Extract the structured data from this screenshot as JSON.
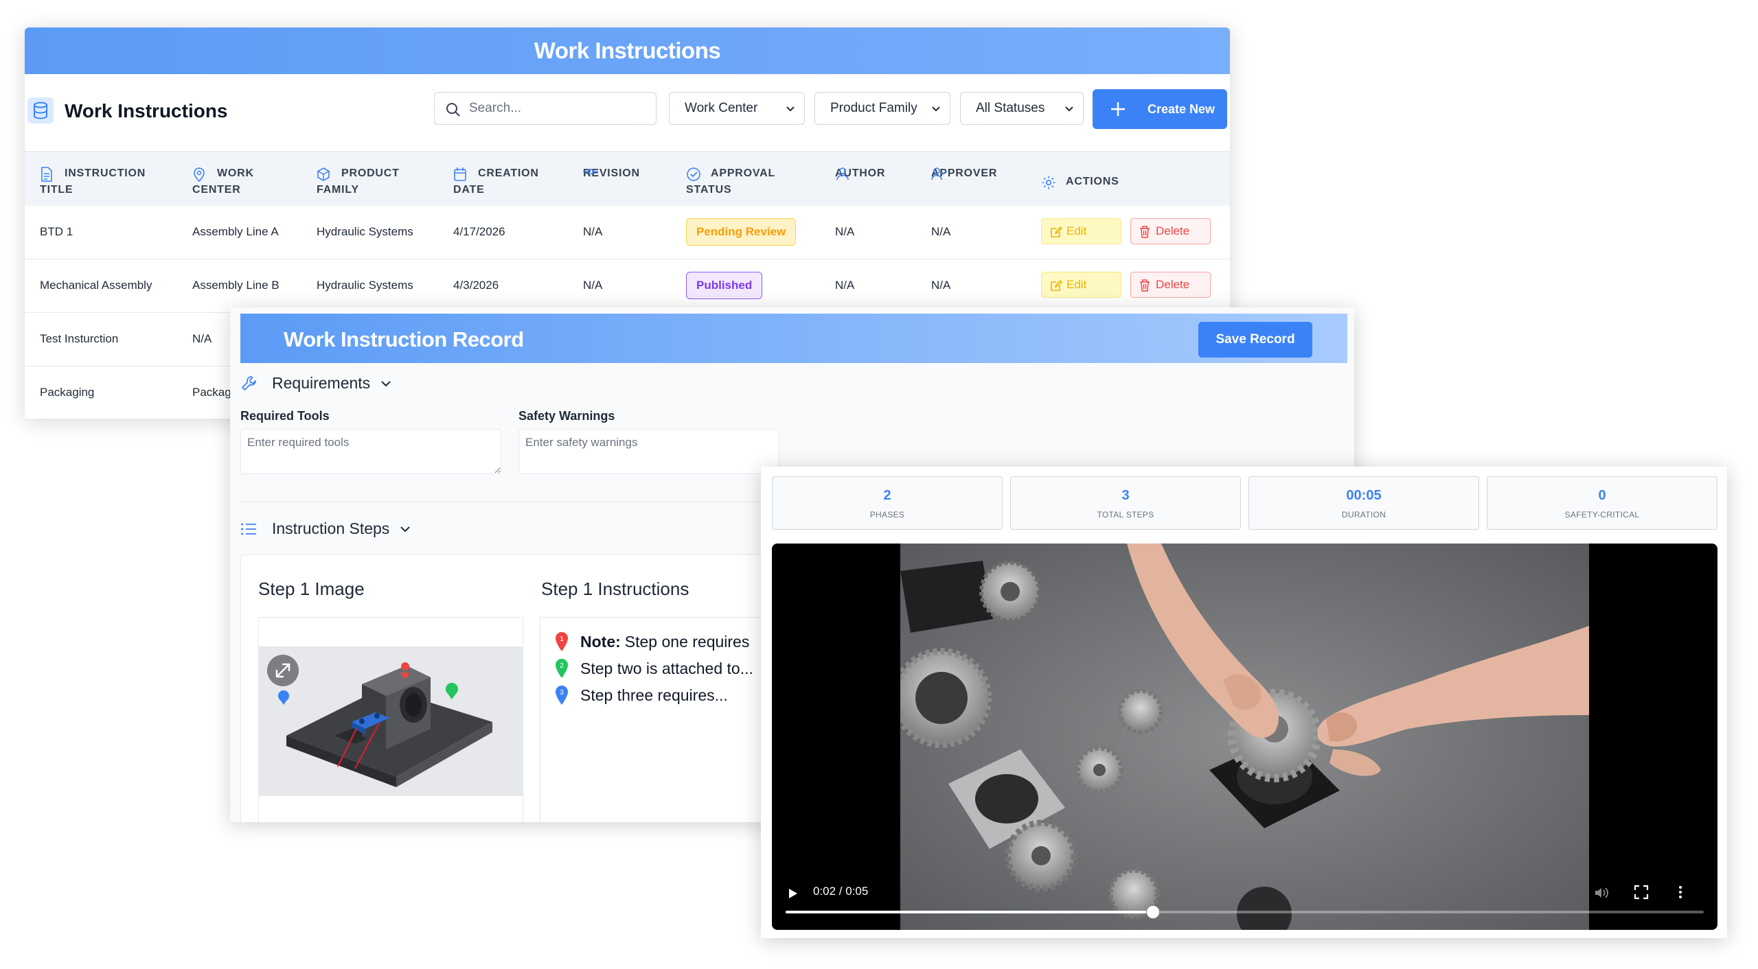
{
  "list_panel": {
    "title_bar": "Work Instructions",
    "heading": "Work Instructions",
    "search": {
      "placeholder": "Search..."
    },
    "filters": [
      "Work Center",
      "Product Family",
      "All Statuses"
    ],
    "create_button": "Create New",
    "columns": [
      {
        "line1": "Instruction",
        "line2": "Title",
        "icon": "document-icon"
      },
      {
        "line1": "Work",
        "line2": "Center",
        "icon": "location-pin-icon"
      },
      {
        "line1": "Product",
        "line2": "Family",
        "icon": "cube-icon"
      },
      {
        "line1": "Creation",
        "line2": "Date",
        "icon": "calendar-icon"
      },
      {
        "line1": "",
        "line2": "Revision",
        "icon": "commit-icon"
      },
      {
        "line1": "Approval",
        "line2": "Status",
        "icon": "check-circle-icon"
      },
      {
        "line1": "",
        "line2": "Author",
        "icon": "user-icon"
      },
      {
        "line1": "",
        "line2": "Approver",
        "icon": "user-check-icon"
      },
      {
        "line1": "Actions",
        "line2": "",
        "icon": "gear-icon"
      }
    ],
    "rows": [
      {
        "title": "BTD 1",
        "work_center": "Assembly Line A",
        "product_family": "Hydraulic Systems",
        "date": "4/17/2026",
        "revision": "N/A",
        "status": "Pending Review",
        "author": "N/A",
        "approver": "N/A"
      },
      {
        "title": "Mechanical Assembly",
        "work_center": "Assembly Line B",
        "product_family": "Hydraulic Systems",
        "date": "4/3/2026",
        "revision": "N/A",
        "status": "Published",
        "author": "N/A",
        "approver": "N/A"
      },
      {
        "title": "Test Insturction",
        "work_center": "N/A"
      },
      {
        "title": "Packaging",
        "work_center": "Packag"
      }
    ],
    "edit_label": "Edit",
    "delete_label": "Delete"
  },
  "record_panel": {
    "title": "Work Instruction Record",
    "save_button": "Save Record",
    "requirements": {
      "heading": "Requirements",
      "tools_label": "Required Tools",
      "tools_placeholder": "Enter required tools",
      "safety_label": "Safety Warnings",
      "safety_placeholder": "Enter safety warnings"
    },
    "steps": {
      "heading": "Instruction Steps",
      "image_heading": "Step 1 Image",
      "instructions_heading": "Step 1 Instructions",
      "lines": [
        {
          "num": "1",
          "bold": "Note:",
          "text": "Step one requires",
          "color": "#ef4444"
        },
        {
          "num": "2",
          "bold": "",
          "text": "Step two is attached to...",
          "color": "#22c55e"
        },
        {
          "num": "3",
          "bold": "",
          "text": "Step three requires...",
          "color": "#3b82f6"
        }
      ]
    }
  },
  "video_panel": {
    "stats": [
      {
        "value": "2",
        "label": "Phases"
      },
      {
        "value": "3",
        "label": "Total Steps"
      },
      {
        "value": "00:05",
        "label": "Duration"
      },
      {
        "value": "0",
        "label": "Safety-Critical"
      }
    ],
    "time_display": "0:02 / 0:05",
    "progress_fraction": 0.4
  },
  "colors": {
    "accent": "#3b82f6",
    "title_gradient_start": "#5b9bf6"
  }
}
